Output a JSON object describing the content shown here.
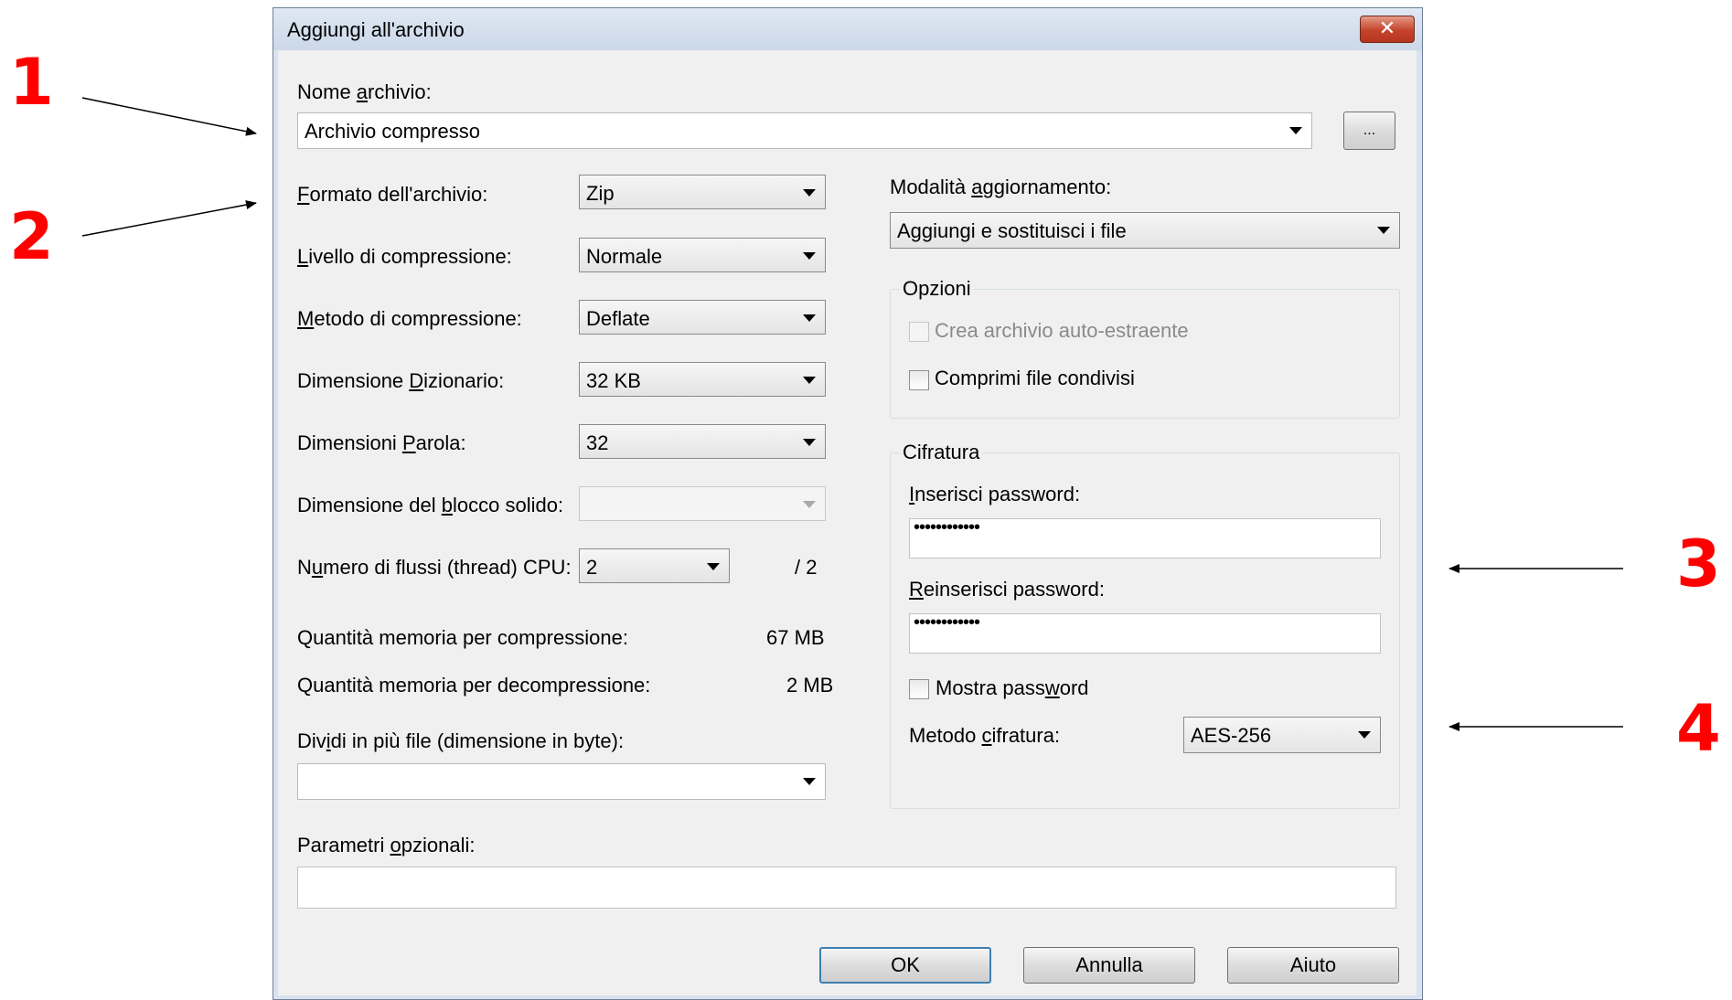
{
  "annotations": {
    "n1": "1",
    "n2": "2",
    "n3": "3",
    "n4": "4"
  },
  "dialog": {
    "title": "Aggiungi all'archivio",
    "close_icon": "close-icon"
  },
  "archive_name": {
    "label_pre": "Nome ",
    "label_key": "a",
    "label_post": "rchivio:",
    "value": "Archivio compresso",
    "browse_label": "..."
  },
  "left": {
    "format": {
      "label_key": "F",
      "label_post": "ormato dell'archivio:",
      "value": "Zip"
    },
    "level": {
      "label_key": "L",
      "label_post": "ivello di compressione:",
      "value": "Normale"
    },
    "method": {
      "label_key": "M",
      "label_post": "etodo di compressione:",
      "value": "Deflate"
    },
    "dictionary": {
      "label_pre": "Dimensione ",
      "label_key": "D",
      "label_post": "izionario:",
      "value": "32 KB"
    },
    "word": {
      "label_pre": "Dimensioni ",
      "label_key": "P",
      "label_post": "arola:",
      "value": "32"
    },
    "solid_block": {
      "label_pre": "Dimensione del ",
      "label_key": "b",
      "label_post": "locco solido:",
      "value": ""
    },
    "threads": {
      "label_pre": "N",
      "label_key": "u",
      "label_post": "mero di flussi (thread) CPU:",
      "value": "2",
      "max": "/ 2"
    },
    "mem_compress": {
      "label": "Quantità memoria per compressione:",
      "value": "67 MB"
    },
    "mem_decompress": {
      "label": "Quantità memoria per decompressione:",
      "value": "2 MB"
    },
    "split": {
      "label_pre": "Div",
      "label_key": "i",
      "label_post": "di in più file (dimensione in byte):",
      "value": ""
    }
  },
  "params": {
    "label_pre": "Parametri ",
    "label_key": "o",
    "label_post": "pzionali:",
    "value": ""
  },
  "right": {
    "update_mode": {
      "label_pre": "Modalità ",
      "label_key": "a",
      "label_post": "ggiornamento:",
      "value": "Aggiungi e sostituisci i file"
    },
    "options": {
      "title": "Opzioni",
      "sfx_label": "Crea archivio auto-estraente",
      "shared_label": "Comprimi file condivisi"
    },
    "encryption": {
      "title": "Cifratura",
      "enter_pw": {
        "label_key": "I",
        "label_post": "nserisci password:",
        "value": "••••••••••••"
      },
      "reenter_pw": {
        "label_key": "R",
        "label_post": "einserisci password:",
        "value": "••••••••••••"
      },
      "show_pw": {
        "label_pre": "Mostra pass",
        "label_key": "w",
        "label_post": "ord"
      },
      "method": {
        "label_pre": "Metodo ",
        "label_key": "c",
        "label_post": "ifratura:",
        "value": "AES-256"
      }
    }
  },
  "buttons": {
    "ok": "OK",
    "cancel": "Annulla",
    "help": "Aiuto"
  }
}
